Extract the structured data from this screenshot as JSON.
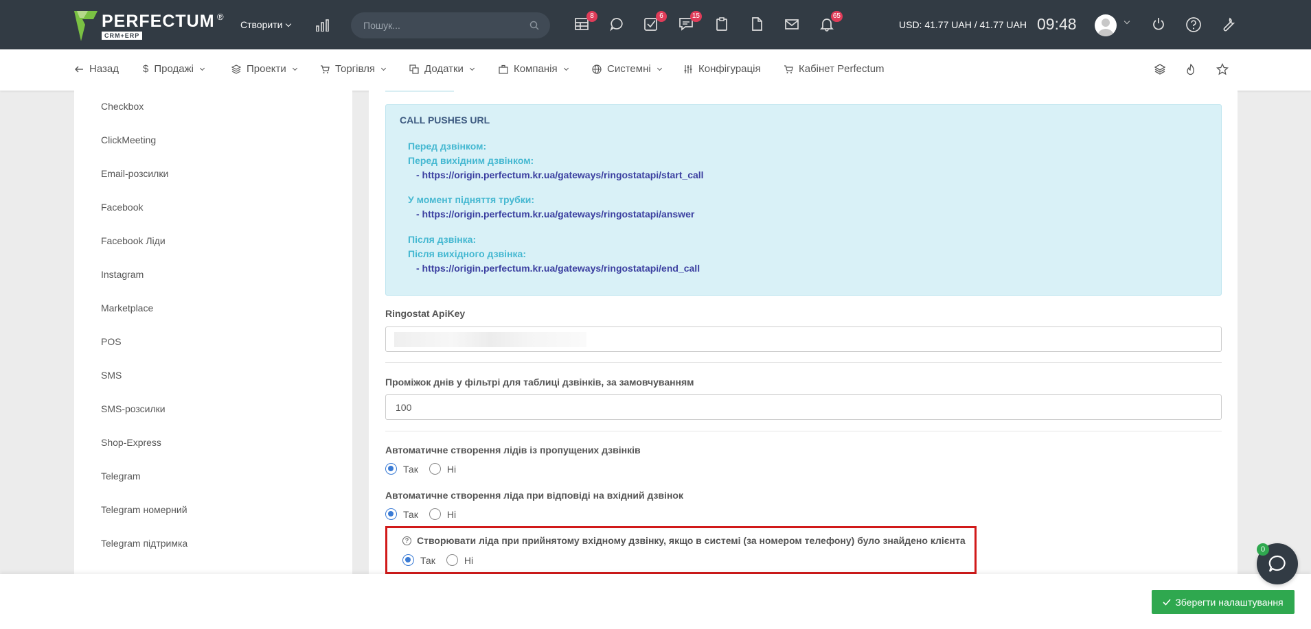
{
  "topbar": {
    "logo_name": "PERFECTUM",
    "logo_reg": "®",
    "logo_sub": "CRM+ERP",
    "create_label": "Створити",
    "search_placeholder": "Пошук...",
    "badges": {
      "tasks_table": "8",
      "todo": "6",
      "chat": "15",
      "notifications": "65"
    },
    "currency": "USD: 41.77 UAH / 41.77 UAH",
    "time": "09:48"
  },
  "nav": {
    "back": "Назад",
    "sales": "Продажі",
    "projects": "Проекти",
    "trade": "Торгівля",
    "addons": "Додатки",
    "company": "Компанія",
    "system": "Системні",
    "config": "Конфігурація",
    "cabinet": "Кабінет Perfectum"
  },
  "sidebar": {
    "items": [
      "Checkbox",
      "ClickMeeting",
      "Email-розсилки",
      "Facebook",
      "Facebook Ліди",
      "Instagram",
      "Marketplace",
      "POS",
      "SMS",
      "SMS-розсилки",
      "Shop-Express",
      "Telegram",
      "Telegram номерний",
      "Telegram підтримка"
    ]
  },
  "info": {
    "title": "CALL PUSHES URL",
    "before_call": "Перед дзвінком:",
    "before_outgoing": "Перед вихідним дзвінком:",
    "start_url": "- https://origin.perfectum.kr.ua/gateways/ringostatapi/start_call",
    "answer_label": "У момент підняття трубки:",
    "answer_url": "- https://origin.perfectum.kr.ua/gateways/ringostatapi/answer",
    "after_call": "Після дзвінка:",
    "after_outgoing": "Після вихідного дзвінка:",
    "end_url": "- https://origin.perfectum.kr.ua/gateways/ringostatapi/end_call"
  },
  "form": {
    "apikey_label": "Ringostat ApiKey",
    "days_label": "Проміжок днів у фільтрі для таблиці дзвінків, за замовчуванням",
    "days_value": "100",
    "missed_label": "Автоматичне створення лідів із пропущених дзвінків",
    "incoming_label": "Автоматичне створення ліда при відповіді на вхідний дзвінок",
    "client_found_label": "Створювати ліда при прийнятому вхідному дзвінку, якщо в системі (за номером телефону) було знайдено клієнта",
    "yes": "Так",
    "no": "Ні"
  },
  "footer": {
    "save": "Зберегти налаштування",
    "chat_badge": "0"
  },
  "colors": {
    "topbar": "#323b44",
    "accent_green": "#2fa84f",
    "info_bg": "#d9f1f7",
    "highlight_red": "#d11a1a"
  }
}
